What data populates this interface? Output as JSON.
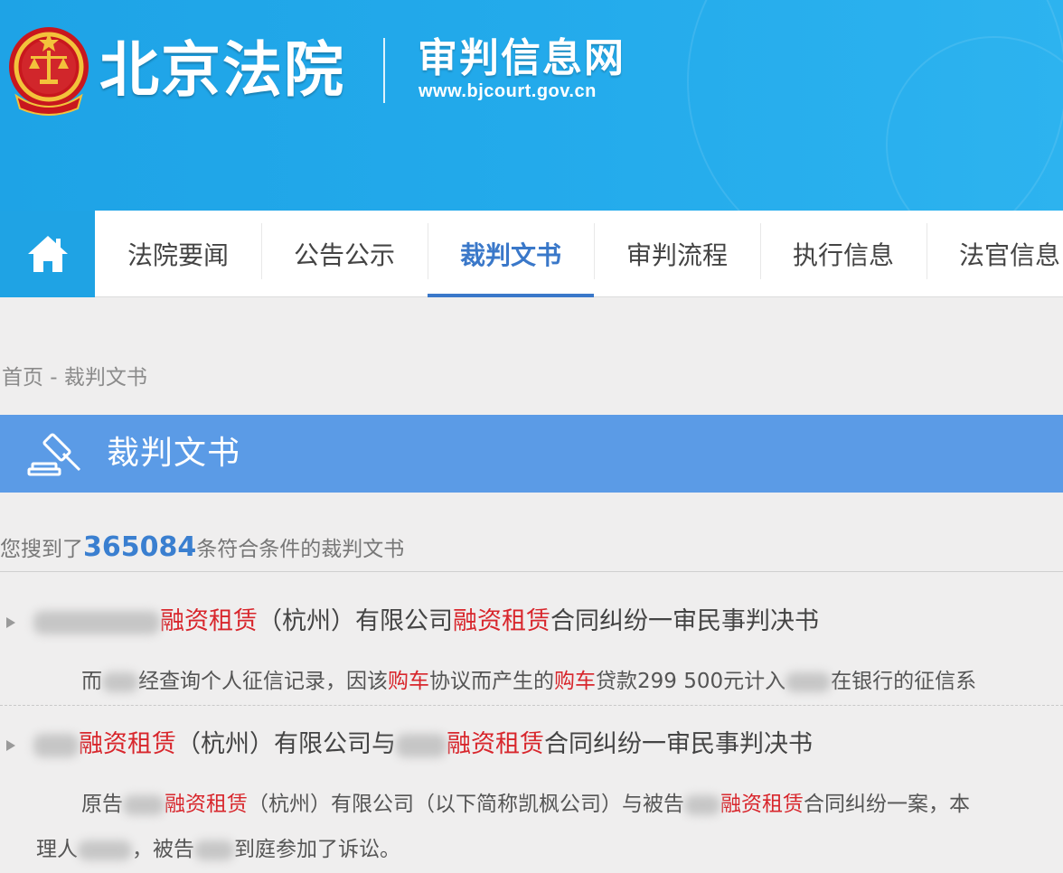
{
  "header": {
    "site_name": "北京法院",
    "site_subtitle": "审判信息网",
    "site_url": "www.bjcourt.gov.cn"
  },
  "nav": {
    "home_icon": "home-icon",
    "items": [
      {
        "label": "法院要闻"
      },
      {
        "label": "公告公示"
      },
      {
        "label": "裁判文书",
        "active": true
      },
      {
        "label": "审判流程"
      },
      {
        "label": "执行信息"
      },
      {
        "label": "法官信息"
      }
    ]
  },
  "breadcrumb": {
    "home": "首页",
    "separator": " - ",
    "current": "裁判文书"
  },
  "section": {
    "icon": "gavel-icon",
    "title": "裁判文书"
  },
  "results_summary": {
    "prefix": "您搜到了",
    "count": "365084",
    "suffix": "条符合条件的裁判文书"
  },
  "results": [
    {
      "title_parts": [
        "融资租赁",
        "（杭州）有限公司",
        "融资租赁",
        "合同纠纷一审民事判决书"
      ],
      "snippet_parts": [
        "而",
        "经查询个人征信记录，因该",
        "购车",
        "协议而产生的",
        "购车",
        "贷款299 500元计入",
        "在银行的征信系"
      ]
    },
    {
      "title_parts": [
        "融资租赁",
        "（杭州）有限公司与",
        "融资租赁",
        "合同纠纷一审民事判决书"
      ],
      "snippet_line1_parts": [
        "原告",
        "融资租赁",
        "（杭州）有限公司（以下简称凯枫公司）与被告",
        "融资租赁",
        "合同纠纷一案，本"
      ],
      "snippet_line2_parts": [
        "理人",
        "，被告",
        "到庭参加了诉讼。"
      ]
    }
  ],
  "colors": {
    "header_blue": "#23aaeb",
    "nav_home_blue": "#1fa3e4",
    "active_blue": "#3a78c9",
    "section_bar_blue": "#5b9be6",
    "highlight_red": "#d8262c",
    "count_blue": "#3a7fd0"
  }
}
